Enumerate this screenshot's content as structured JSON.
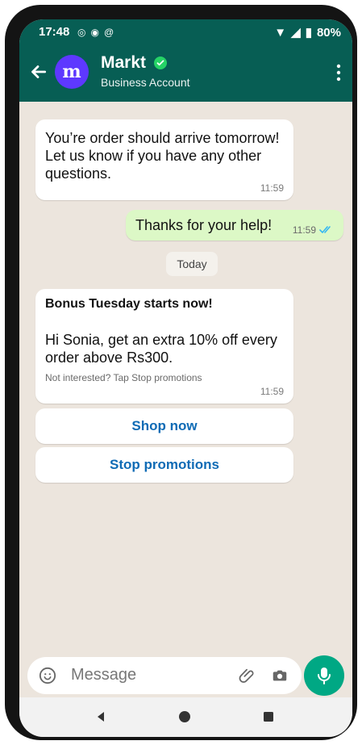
{
  "status_bar": {
    "time": "17:48",
    "battery": "80%"
  },
  "chat_header": {
    "title": "Markt",
    "subtitle": "Business Account",
    "avatar_letter": "m"
  },
  "messages": {
    "incoming_1": {
      "text": "You’re order should arrive tomorrow! Let us know if you have any other questions.",
      "time": "11:59"
    },
    "outgoing_1": {
      "text": "Thanks for your help!",
      "time": "11:59"
    },
    "date_separator": "Today",
    "promo": {
      "title": "Bonus Tuesday starts now!",
      "text": "Hi Sonia, get an extra 10% off every order above Rs300.",
      "footer": "Not interested? Tap Stop promotions",
      "time": "11:59"
    }
  },
  "actions": {
    "shop_now": "Shop now",
    "stop_promotions": "Stop promotions"
  },
  "composer": {
    "placeholder": "Message"
  },
  "colors": {
    "header_green": "#075e54",
    "bubble_green": "#dcf8c6",
    "accent_blue": "#0f6bb5",
    "mic_green": "#00a884",
    "avatar_purple": "#5e38ff"
  }
}
